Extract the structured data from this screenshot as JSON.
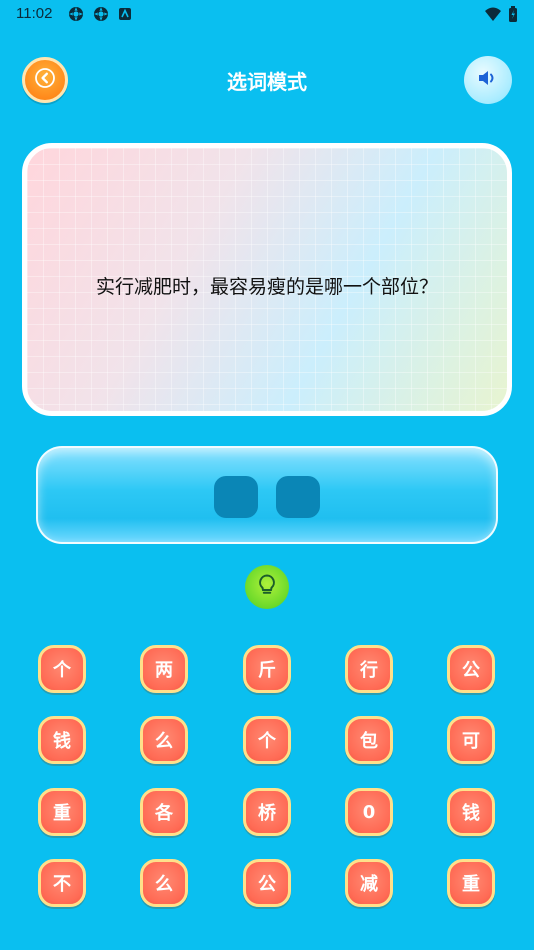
{
  "status_bar": {
    "time": "11:02",
    "icons": [
      "settings-icon",
      "settings-icon",
      "notification-icon",
      "wifi-icon",
      "battery-icon"
    ]
  },
  "header": {
    "title": "选词模式",
    "back_icon": "chevron-left-icon",
    "sound_icon": "speaker-icon"
  },
  "question": {
    "text": "实行减肥时，最容易瘦的是哪一个部位？"
  },
  "answer": {
    "slots": [
      "",
      ""
    ]
  },
  "hint": {
    "icon": "lightbulb-icon"
  },
  "letters": [
    [
      "个",
      "两",
      "斤",
      "行",
      "公"
    ],
    [
      "钱",
      "么",
      "个",
      "包",
      "可"
    ],
    [
      "重",
      "各",
      "桥",
      "0",
      "钱"
    ],
    [
      "不",
      "么",
      "公",
      "减",
      "重"
    ]
  ],
  "colors": {
    "background": "#0abff0",
    "letter_fill": "#ff6b55",
    "letter_border": "#ffe08a",
    "back_button": "#ff8a1c",
    "hint_button": "#6ad92a",
    "slot": "#0a86b6"
  }
}
